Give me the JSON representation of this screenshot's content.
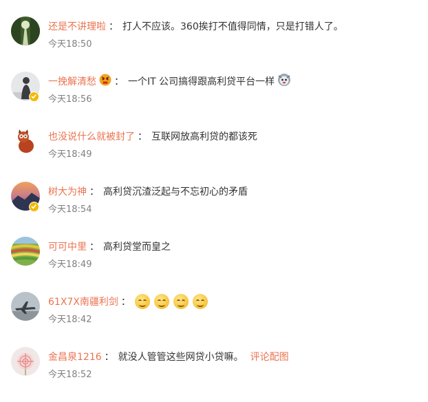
{
  "comments": [
    {
      "user": "还是不讲理啦",
      "separator": "：",
      "text": "打人不应该。360挨打不值得同情，只是打错人了。",
      "time": "今天18:50"
    },
    {
      "user": "一挽解清愁",
      "separator": "：",
      "text": "一个IT 公司搞得跟高利贷平台一样",
      "time": "今天18:56",
      "user_icon": "angry-face-emoji-icon",
      "text_icon": "cat-face-emoji-icon",
      "verified": true
    },
    {
      "user": "也没说什么就被封了",
      "separator": "：",
      "text": "互联网放高利贷的都该死",
      "time": "今天18:49"
    },
    {
      "user": "树大为神",
      "separator": "：",
      "text": "高利贷沉渣泛起与不忘初心的矛盾",
      "time": "今天18:54",
      "verified": true
    },
    {
      "user": "可可中里",
      "separator": "：",
      "text": "高利贷堂而皇之",
      "time": "今天18:49"
    },
    {
      "user": "61X7X南疆利剑",
      "separator": "：",
      "text": "",
      "time": "今天18:42",
      "emojis": [
        "smile-emoji-icon",
        "smile-emoji-icon",
        "smile-emoji-icon",
        "smile-emoji-icon"
      ]
    },
    {
      "user": "金昌泉1216",
      "separator": "：",
      "text": "就没人管管这些网贷小贷嘛。",
      "time": "今天18:52",
      "link": "评论配图"
    }
  ],
  "colors": {
    "username": "#eb7350",
    "text": "#333333",
    "time": "#808080",
    "verified_badge": "#f5b800"
  }
}
